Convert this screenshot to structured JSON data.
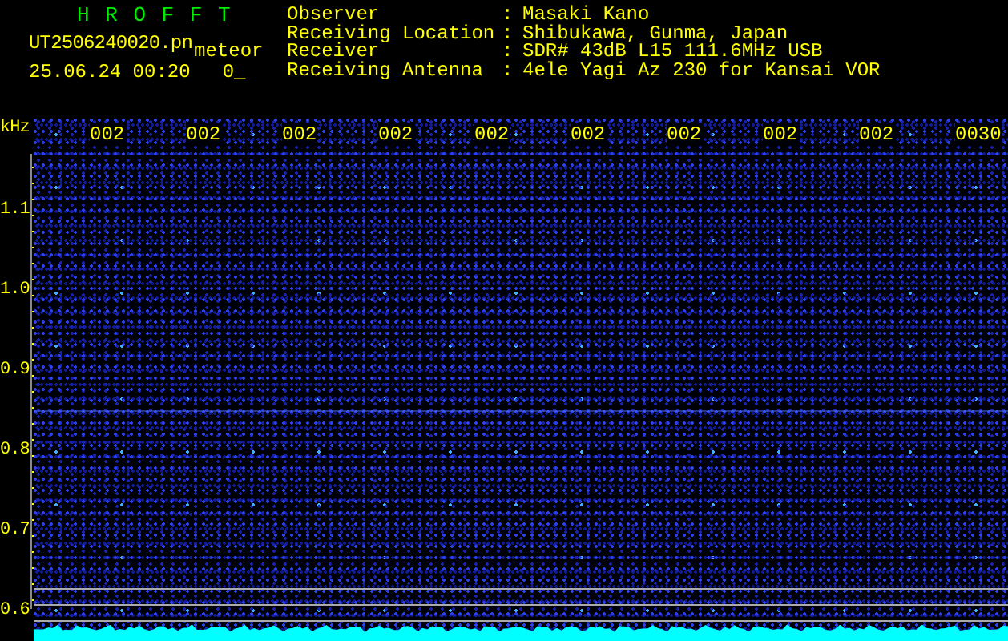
{
  "header": {
    "title": "H R O F F T",
    "file_name": "UT2506240020.pn",
    "mode": "meteor",
    "timestamp": "25.06.24 00:20",
    "counter": "0_"
  },
  "station_info": [
    {
      "label": "Observer",
      "separator": ":",
      "value": "Masaki Kano"
    },
    {
      "label": "Receiving Location",
      "separator": ":",
      "value": "Shibukawa, Gunma, Japan"
    },
    {
      "label": "Receiver",
      "separator": ":",
      "value": "SDR# 43dB L15 111.6MHz USB"
    },
    {
      "label": "Receiving Antenna",
      "separator": ":",
      "value": "4ele Yagi Az 230 for Kansai VOR"
    }
  ],
  "spectrogram": {
    "y_unit": "kHz",
    "y_labels": [
      "1.1",
      "1.0",
      "0.9",
      "0.8",
      "0.7",
      "0.6"
    ],
    "time_labels": [
      "002",
      "002",
      "002",
      "002",
      "002",
      "002",
      "002",
      "002",
      "002",
      "0030"
    ]
  }
}
